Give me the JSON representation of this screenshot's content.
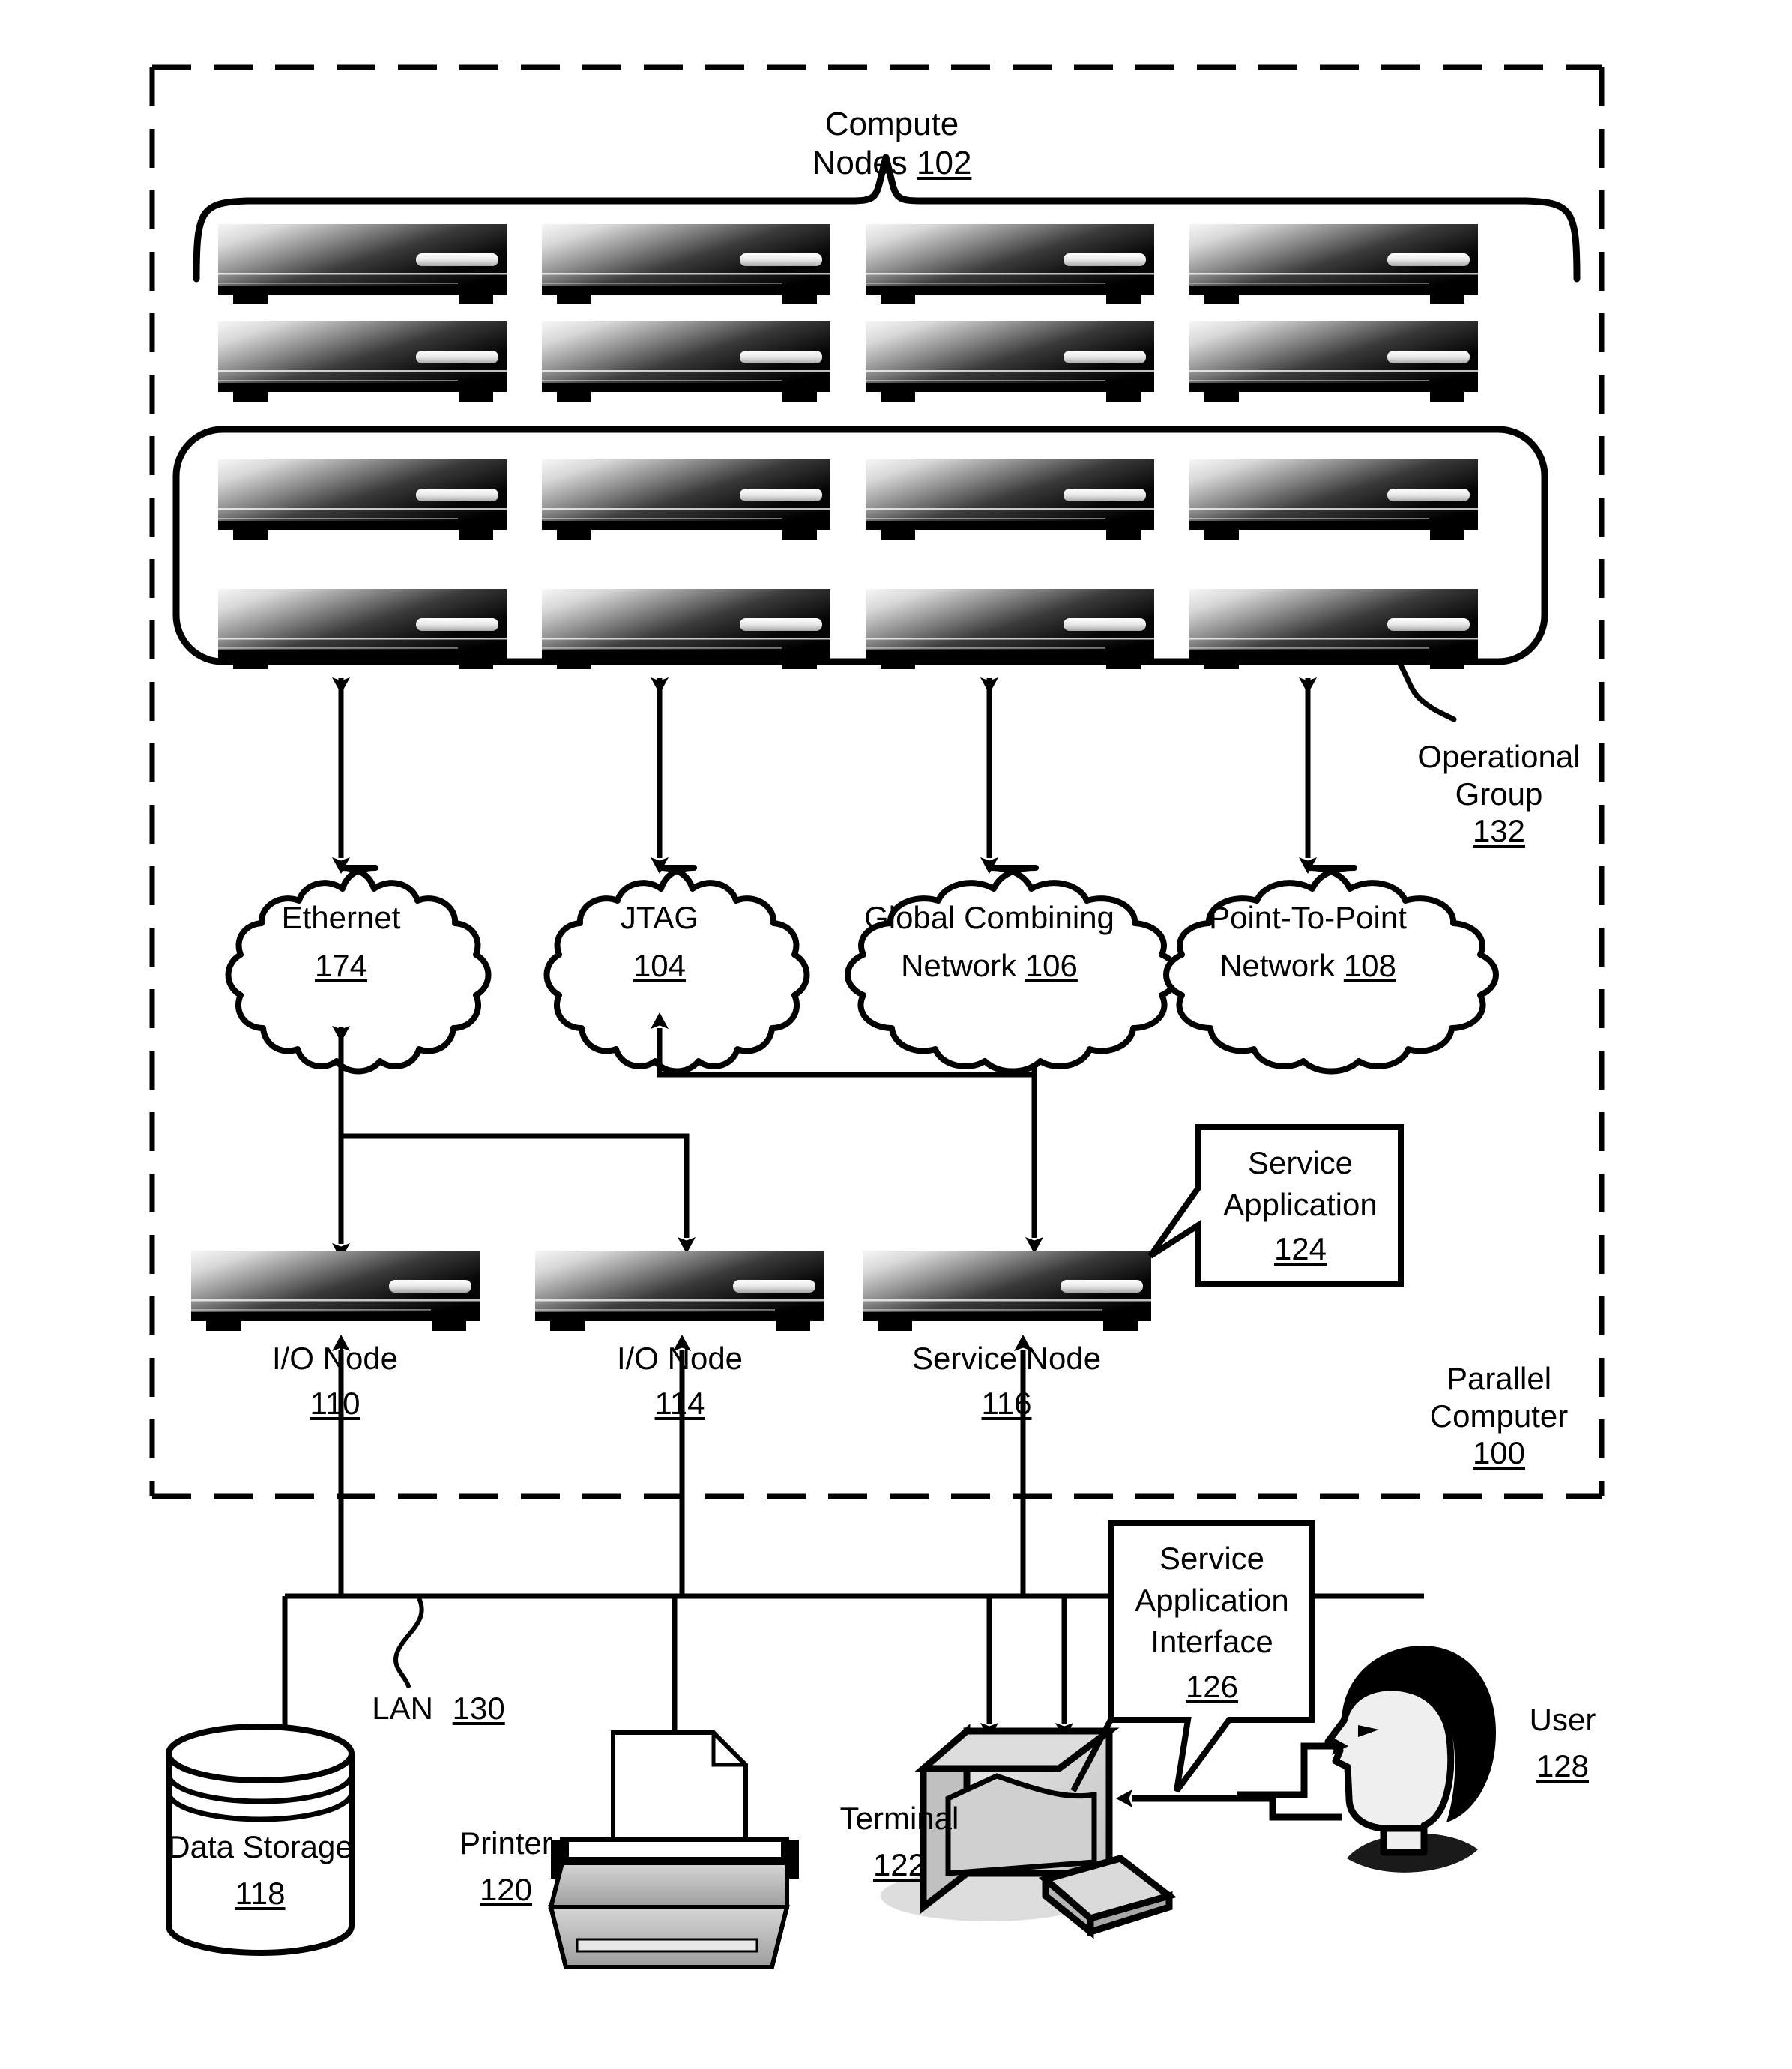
{
  "figure": {
    "title": "Parallel Computer block diagram",
    "enclosure_label": {
      "line1": "Parallel",
      "line2": "Computer",
      "ref": "100"
    }
  },
  "compute": {
    "header_label": "Compute Nodes",
    "header_ref": "102",
    "node_count_top_group": 8,
    "node_count_operational_group": 8,
    "operational_group": {
      "line1": "Operational",
      "line2": "Group",
      "ref": "132"
    }
  },
  "networks": [
    {
      "name": "Ethernet",
      "line2": "",
      "ref": "174"
    },
    {
      "name": "JTAG",
      "line2": "",
      "ref": "104"
    },
    {
      "name": "Global Combining",
      "line2": "Network",
      "ref": "106"
    },
    {
      "name": "Point-To-Point",
      "line2": "Network",
      "ref": "108"
    }
  ],
  "service_tier": [
    {
      "name": "I/O Node",
      "ref": "110"
    },
    {
      "name": "I/O Node",
      "ref": "114"
    },
    {
      "name": "Service Node",
      "ref": "116"
    }
  ],
  "callouts": {
    "service_application": {
      "line1": "Service",
      "line2": "Application",
      "ref": "124"
    },
    "service_application_interface": {
      "line1": "Service",
      "line2": "Application",
      "line3": "Interface",
      "ref": "126"
    }
  },
  "lan": {
    "name": "LAN",
    "ref": "130"
  },
  "peripherals": {
    "data_storage": {
      "name": "Data Storage",
      "ref": "118"
    },
    "printer": {
      "name": "Printer",
      "ref": "120"
    },
    "terminal": {
      "name": "Terminal",
      "ref": "122"
    },
    "user": {
      "name": "User",
      "ref": "128"
    }
  },
  "colors": {
    "ink": "#000000",
    "paper": "#ffffff",
    "node_light": "#f2f2f2",
    "node_mid": "#8a8a8a",
    "node_dark": "#0a0a0a",
    "screen_fill": "#d8d8d8",
    "printer_fill": "#b9b9b9"
  }
}
